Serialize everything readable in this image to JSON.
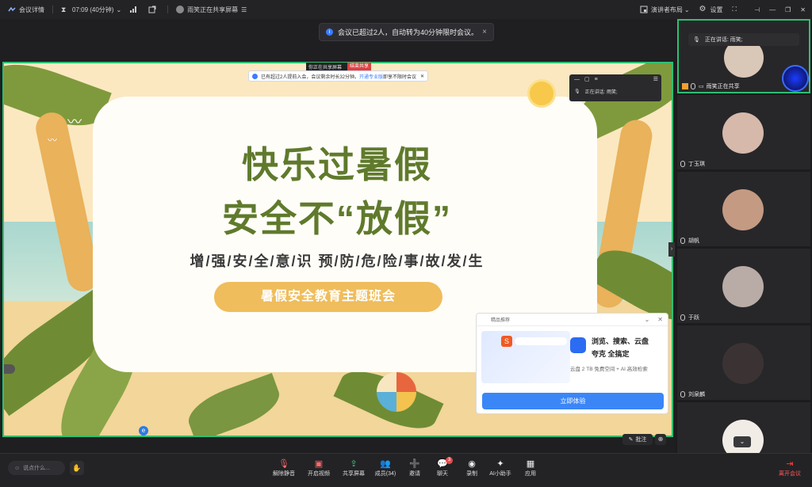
{
  "topbar": {
    "meeting_details": "会议详情",
    "timer": "07:09 (40分钟)",
    "sharing_status": "雨笑正在共享屏幕",
    "presenter_layout": "演讲者布局",
    "settings": "设置"
  },
  "notice": {
    "text": "会议已超过2人，自动转为40分钟限时会议。",
    "close": "×"
  },
  "shared_content": {
    "share_strip_text": "你正在共享屏幕",
    "share_stop": "结束共享",
    "inner_banner_prefix": "已有超过2人提前入会，会议剩余时长32分钟。",
    "inner_banner_link": "开通专业版",
    "inner_banner_suffix": "即享不限时会议",
    "inner_speaker": "正在讲话: 雨笑;",
    "title_line1": "快乐过暑假",
    "title_line2": "安全不“放假”",
    "subtitle": "增/强/安/全/意/识  预/防/危/险/事/故/发/生",
    "pill": "暑假安全教育主题班会"
  },
  "promo": {
    "header": "精品推荐",
    "line1": "浏览、搜索、云盘",
    "line2": "夸克 全搞定",
    "line3": "云盘 2 TB 免费空间 + AI 高效检索",
    "cta": "立即体验"
  },
  "stage_tools": {
    "annotate": "批注"
  },
  "participants": [
    {
      "name": "雨笑正在共享",
      "speaking_label": "正在讲话: 雨笑;",
      "color": "#d9c7b8"
    },
    {
      "name": "丁玉琪",
      "color": "#d6b9aa"
    },
    {
      "name": "胡帆",
      "color": "#c49a82"
    },
    {
      "name": "于跃",
      "color": "#b9aca6"
    },
    {
      "name": "刘泉麟",
      "color": "#3b3333"
    },
    {
      "name": "",
      "color": "#f1ece6"
    }
  ],
  "bottombar": {
    "chat_placeholder": "说点什么...",
    "tools": [
      {
        "label": "解除静音",
        "glyph": "🎙"
      },
      {
        "label": "开启视频",
        "glyph": "▣"
      },
      {
        "label": "共享屏幕",
        "glyph": "⇪"
      },
      {
        "label": "成员(34)",
        "glyph": "👥"
      },
      {
        "label": "邀请",
        "glyph": "➕"
      },
      {
        "label": "聊天",
        "glyph": "💬",
        "badge": "3"
      },
      {
        "label": "录制",
        "glyph": "◉"
      },
      {
        "label": "AI小助手",
        "glyph": "✦"
      },
      {
        "label": "应用",
        "glyph": "▦"
      }
    ],
    "leave": "离开会议"
  },
  "colors": {
    "accent_green": "#2fbf71",
    "primary_blue": "#3b86f7",
    "olive_title": "#5f7a2c",
    "pill_orange": "#efbd5c"
  }
}
